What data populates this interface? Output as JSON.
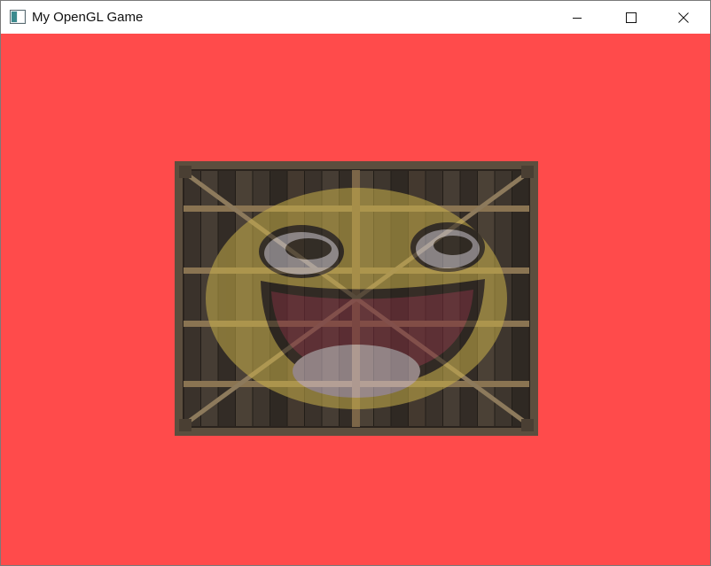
{
  "window": {
    "title": "My OpenGL Game",
    "icon": "app-window-icon",
    "controls": [
      "minimize-icon",
      "maximize-icon",
      "close-icon"
    ]
  },
  "scene": {
    "clear_color": "#ff4b4b",
    "textures": [
      "wooden-container",
      "awesome-face"
    ],
    "mix": 0.2
  }
}
